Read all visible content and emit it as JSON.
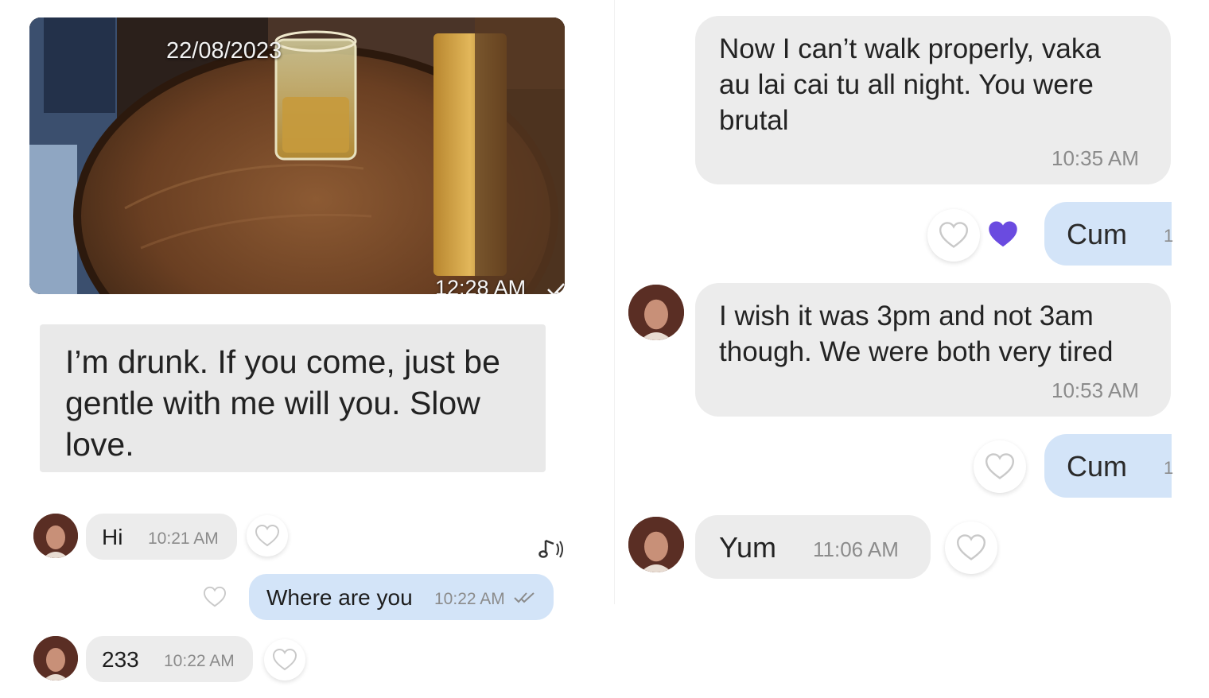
{
  "left_panel": {
    "photo_message": {
      "date": "22/08/2023",
      "time": "12:28 AM"
    },
    "long_message": {
      "lines": [
        "I’m drunk. If you come, just be",
        "gentle with me will you. Slow",
        "love."
      ]
    },
    "messages": [
      {
        "text": "Hi",
        "time": "10:21 AM"
      },
      {
        "text": "Where are you",
        "time": "10:22 AM"
      },
      {
        "text": "233",
        "time": "10:22 AM"
      }
    ]
  },
  "right_panel": {
    "messages": [
      {
        "lines": [
          "Now I can’t walk properly, vaka",
          "au lai cai tu all night.  You were",
          "brutal"
        ],
        "time": "10:35 AM"
      },
      {
        "text": "Cum",
        "edge_char": "1"
      },
      {
        "lines": [
          "I wish it was 3pm and not 3am",
          "though. We were both very tired"
        ],
        "time": "10:53 AM"
      },
      {
        "text": "Cum",
        "edge_char": "1"
      },
      {
        "text": "Yum",
        "time": "11:06 AM"
      }
    ]
  },
  "icons": {
    "heart": "heart-outline-icon",
    "liked_heart": "heart-filled-icon",
    "read_receipt": "double-check-icon",
    "sound": "music-note-icon"
  },
  "colors": {
    "received_bubble": "#ececec",
    "sent_bubble": "#d3e4f8",
    "liked_heart": "#6a4be0",
    "timestamp": "#8b8b8b"
  }
}
